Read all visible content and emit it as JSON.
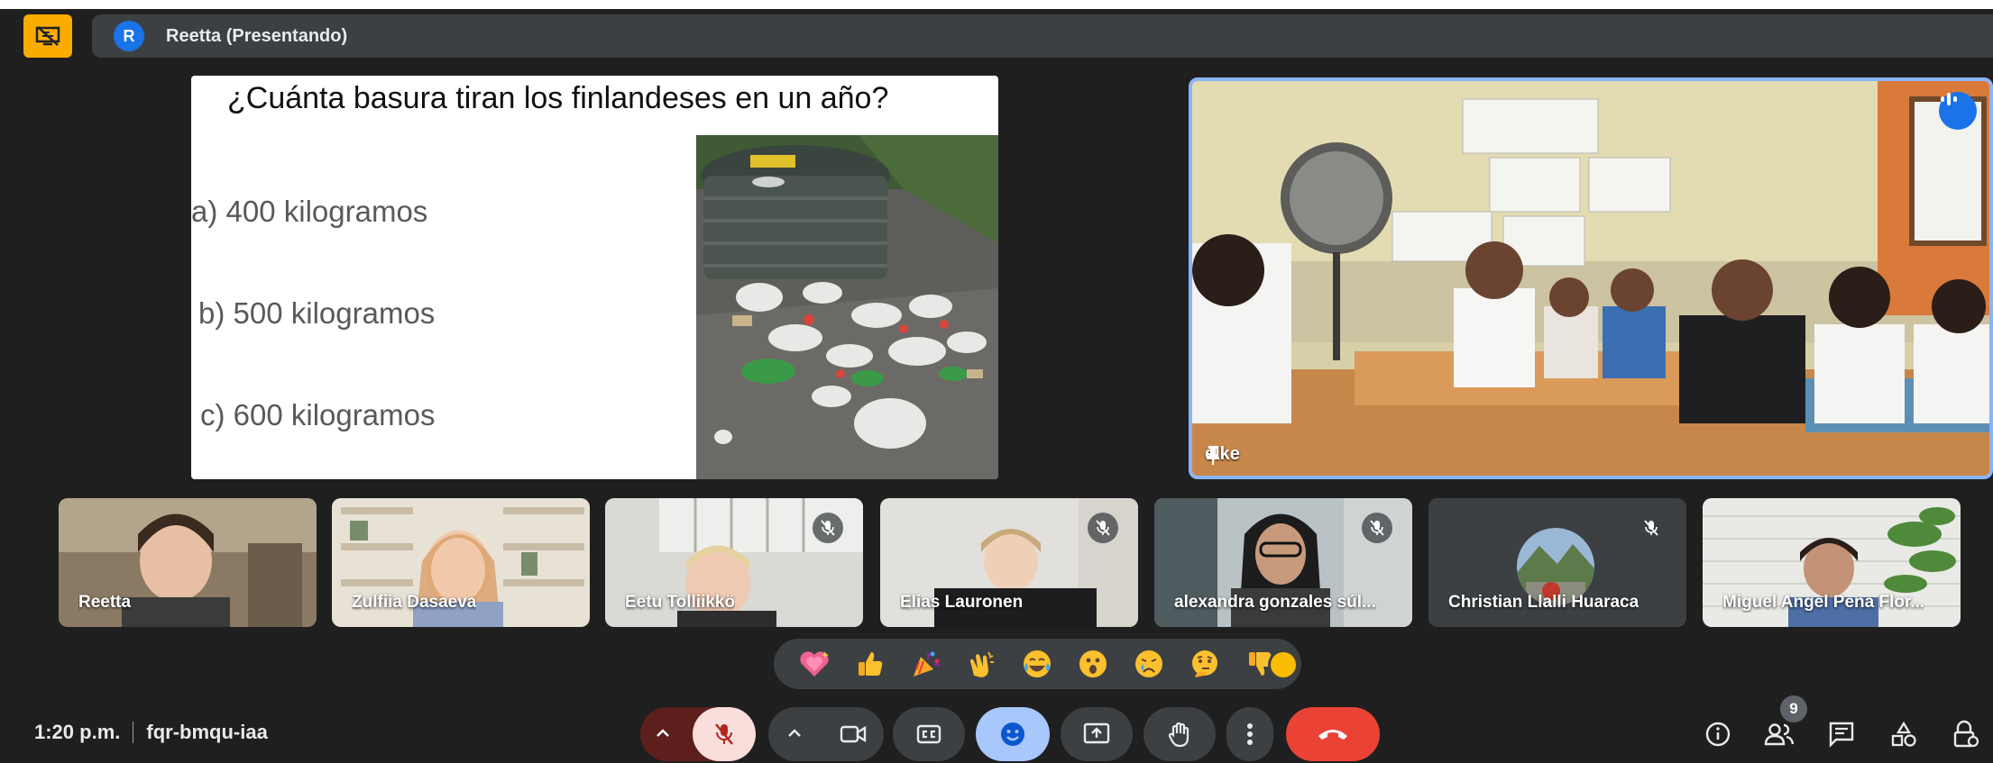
{
  "presenter_bar": {
    "avatar_initial": "R",
    "label": "Reetta (Presentando)"
  },
  "slide": {
    "title": "¿Cuánta basura tiran los finlandeses en un año?",
    "options": [
      "a)  400 kilogramos",
      "b) 500 kilogramos",
      "c) 600 kilogramos"
    ]
  },
  "featured": {
    "name": "elke"
  },
  "participants": [
    {
      "name": "Reetta",
      "muted": false
    },
    {
      "name": "Zulfiia Dasaeva",
      "muted": false
    },
    {
      "name": "Eetu Tolliikkö",
      "muted": true
    },
    {
      "name": "Elias Lauronen",
      "muted": true
    },
    {
      "name": "alexandra gonzales súl...",
      "muted": true
    },
    {
      "name": "Christian Llalli Huaraca",
      "muted": true
    },
    {
      "name": "Miguel Angel Pena Flor...",
      "muted": false
    }
  ],
  "reactions": [
    "sparkling-heart",
    "thumbs-up",
    "party-popper",
    "clapping-hands",
    "tears-of-joy",
    "surprised-face",
    "crying-face",
    "thinking-face",
    "thumbs-down"
  ],
  "meeting": {
    "time": "1:20 p.m.",
    "code": "fqr-bmqu-iaa"
  },
  "participant_count": "9",
  "colors": {
    "background": "#1f1f1f",
    "accent_blue": "#8ab4f8",
    "end_call_red": "#ea4335",
    "mic_off_red": "#f9dedc"
  }
}
